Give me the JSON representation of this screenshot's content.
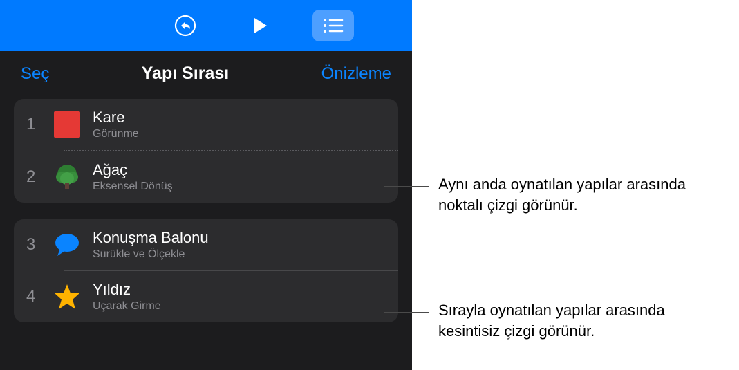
{
  "header": {
    "select_label": "Seç",
    "title": "Yapı Sırası",
    "preview_label": "Önizleme"
  },
  "build_groups": [
    {
      "items": [
        {
          "number": "1",
          "title": "Kare",
          "subtitle": "Görünme"
        },
        {
          "number": "2",
          "title": "Ağaç",
          "subtitle": "Eksensel Dönüş"
        }
      ],
      "divider_style": "dotted"
    },
    {
      "items": [
        {
          "number": "3",
          "title": "Konuşma Balonu",
          "subtitle": "Sürükle ve Ölçekle"
        },
        {
          "number": "4",
          "title": "Yıldız",
          "subtitle": "Uçarak Girme"
        }
      ],
      "divider_style": "solid"
    }
  ],
  "callouts": {
    "simultaneous": "Aynı anda oynatılan yapılar arasında noktalı çizgi görünür.",
    "sequential": "Sırayla oynatılan yapılar arasında kesintisiz çizgi görünür."
  }
}
